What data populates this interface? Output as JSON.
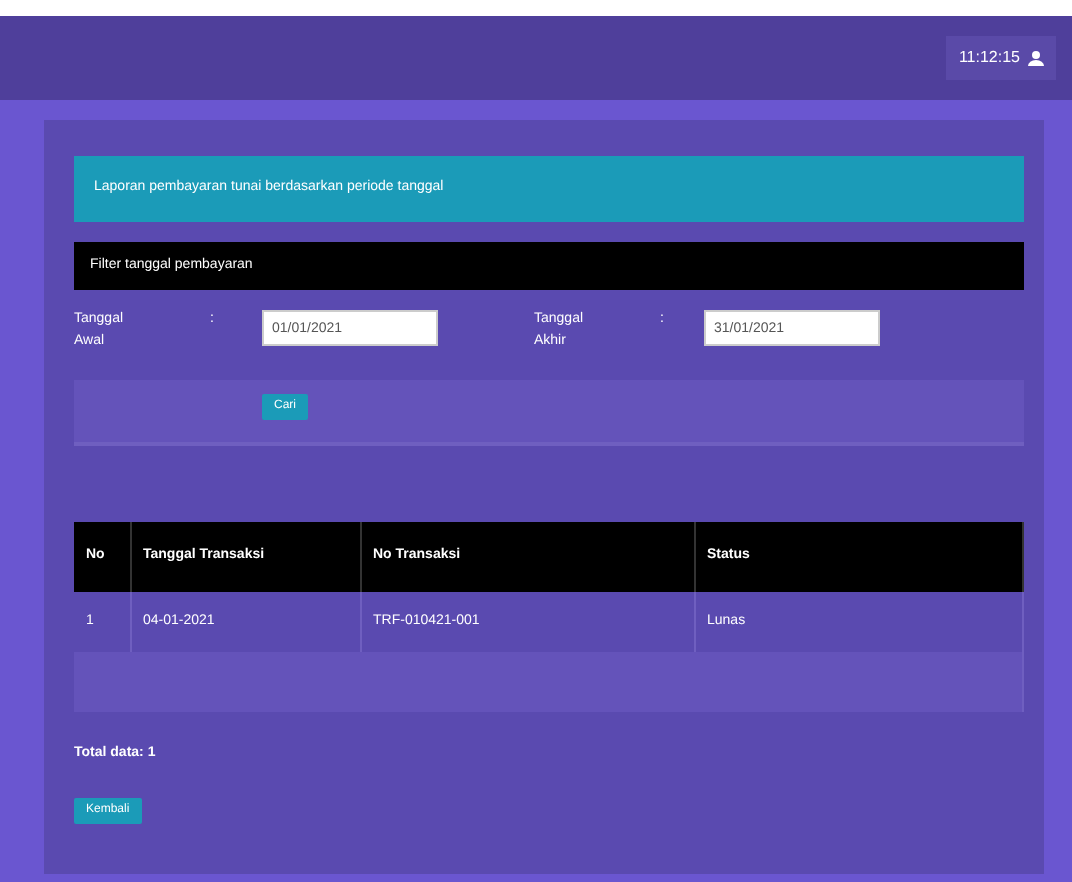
{
  "header": {
    "user": "11:12:15"
  },
  "banner": "Laporan pembayaran tunai berdasarkan periode tanggal",
  "section_title": "Filter tanggal pembayaran",
  "filters": [
    {
      "label": "Tanggal Awal",
      "colon": ":",
      "value": "01/01/2021"
    },
    {
      "label": "Tanggal Akhir",
      "colon": ":",
      "value": "31/01/2021"
    }
  ],
  "search_button": "Cari",
  "table": {
    "columns": [
      "No",
      "Tanggal Transaksi",
      "No Transaksi",
      "Status"
    ],
    "rows": [
      [
        "1",
        "04-01-2021",
        "TRF-010421-001",
        "Lunas"
      ]
    ]
  },
  "total": "Total data: 1",
  "back_button": "Kembali"
}
